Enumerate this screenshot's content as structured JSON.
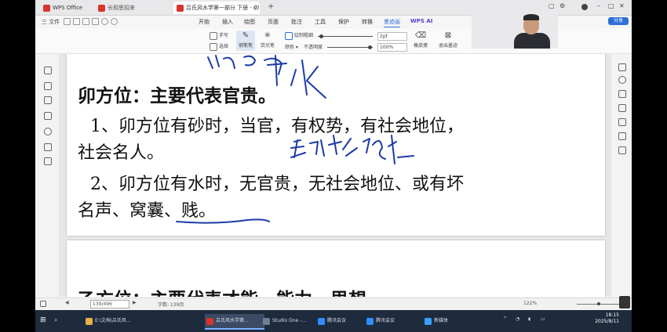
{
  "tabs": {
    "app": "WPS Office",
    "home": "长相思招来",
    "doc": "吕氏风水学第一部分 下册 - 卯",
    "add": "+"
  },
  "menu": {
    "file": "三 文件",
    "tabs": [
      "开始",
      "插入",
      "绘图",
      "页面",
      "批注",
      "工具",
      "保护",
      "转换",
      "墨迹画"
    ],
    "ai": "WPS AI",
    "share": "分享"
  },
  "ribbon": {
    "pen_label": "手写",
    "eraser_label": "选择",
    "pen1_label": "钢笔笔",
    "pen2_label": "荧光笔",
    "thickness_label": "绘制粗细",
    "color_label": "颜色",
    "opacity_label": "不透明度",
    "size_value": "2pt",
    "opacity_value": "100%",
    "clear_label": "橡皮擦",
    "exit_label": "退出墨迹"
  },
  "document": {
    "heading1": "卯方位：主要代表官贵。",
    "line1": "1、卯方位有砂时，当官，有权势，有社会地位，",
    "line2": "社会名人。",
    "line3": "2、卯方位有水时，无官贵，无社会地位、或有坏",
    "line4": "名声、窝囊、贱。",
    "heading2": "乙方位：主要代表才能、能力、思想。"
  },
  "status": {
    "page_text": "139/496",
    "words": "字数: 139页",
    "zoom": "122%"
  },
  "taskbar": {
    "items": [
      {
        "label": "E:\\文档\\吕氏风...",
        "color": "#e8b14a"
      },
      {
        "label": "吕氏风水学第...",
        "color": "#d9342b"
      },
      {
        "label": "Studio One -...",
        "color": "#6d7f96"
      },
      {
        "label": "腾讯会议",
        "color": "#2f8cff"
      },
      {
        "label": "腾讯会议",
        "color": "#2f8cff"
      },
      {
        "label": "新媒体",
        "color": "#3aa0ff"
      }
    ],
    "time": "18:15",
    "date": "2025/8/11"
  },
  "colors": {
    "accent": "#2f6fd6",
    "ink": "#1c3aa8",
    "wps_red": "#d9342b"
  }
}
